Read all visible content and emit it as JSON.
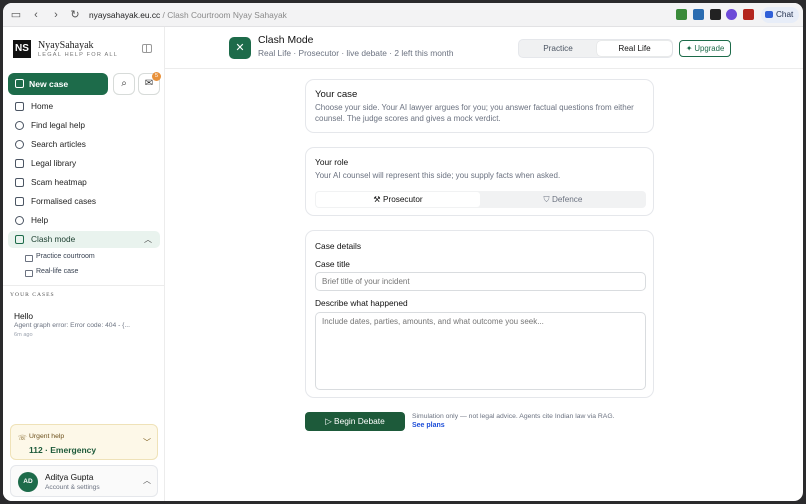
{
  "browser": {
    "url_domain": "nyaysahayak.eu.cc",
    "url_rest": " / Clash Courtroom Nyay Sahayak",
    "chat_label": "Chat"
  },
  "sidebar": {
    "brand": "NyaySahayak",
    "tagline": "LEGAL HELP FOR ALL",
    "logo_text": "NS",
    "new_case_label": "New case",
    "inbox_badge": "5",
    "nav": [
      {
        "label": "Home",
        "icon": "home-icon"
      },
      {
        "label": "Find legal help",
        "icon": "users-icon"
      },
      {
        "label": "Search articles",
        "icon": "search-icon"
      },
      {
        "label": "Legal library",
        "icon": "book-icon"
      },
      {
        "label": "Scam heatmap",
        "icon": "map-icon"
      },
      {
        "label": "Formalised cases",
        "icon": "briefcase-icon"
      },
      {
        "label": "Help",
        "icon": "help-icon"
      },
      {
        "label": "Clash mode",
        "icon": "swords-icon"
      }
    ],
    "sub_nav": [
      "Practice courtroom",
      "Real-life case"
    ],
    "your_cases_label": "YOUR CASES",
    "cases": [
      {
        "title": "Hello",
        "subtitle": "Agent graph error: Error code: 404 - {...",
        "time": "6m ago"
      }
    ],
    "urgent": {
      "label": "Urgent help",
      "number": "112 · Emergency"
    },
    "user": {
      "name": "Aditya Gupta",
      "initials": "AD",
      "subtitle": "Account & settings"
    }
  },
  "header": {
    "title": "Clash Mode",
    "subtitle": "Real Life · Prosecutor · live debate · 2 left this month",
    "tabs": [
      "Practice",
      "Real Life"
    ],
    "selected_tab": "Real Life",
    "upgrade_label": "Upgrade"
  },
  "main": {
    "your_case": {
      "title": "Your case",
      "body": "Choose your side. Your AI lawyer argues for you; you answer factual questions from either counsel. The judge scores and gives a mock verdict."
    },
    "your_role": {
      "title": "Your role",
      "body": "Your AI counsel will represent this side; you supply facts when asked.",
      "options": [
        "Prosecutor",
        "Defence"
      ],
      "selected": "Prosecutor"
    },
    "details": {
      "title": "Case details",
      "case_title_label": "Case title",
      "case_title_placeholder": "Brief title of your incident",
      "describe_label": "Describe what happened",
      "describe_placeholder": "Include dates, parties, amounts, and what outcome you seek..."
    },
    "begin_label": "Begin Debate",
    "disclaimer": "Simulation only — not legal advice. Agents cite Indian law via RAG.",
    "see_plans": "See plans"
  },
  "colors": {
    "accent": "#1d6b4a",
    "dark_accent": "#1d5a3a",
    "link": "#1d4ed8"
  }
}
